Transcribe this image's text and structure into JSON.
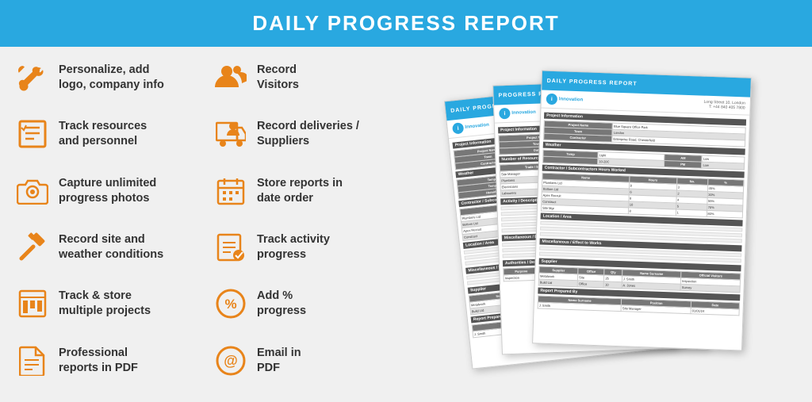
{
  "header": {
    "title": "DAILY PROGRESS REPORT"
  },
  "features": [
    {
      "id": "personalize",
      "icon": "wrench",
      "text": "Personalize, add logo, company info"
    },
    {
      "id": "record-visitors",
      "icon": "visitors",
      "text": "Record Visitors"
    },
    {
      "id": "track-resources",
      "icon": "checklist",
      "text": "Track resources and personnel"
    },
    {
      "id": "record-deliveries",
      "icon": "delivery",
      "text": "Record deliveries / Suppliers"
    },
    {
      "id": "capture-photos",
      "icon": "camera",
      "text": "Capture unlimited progress photos"
    },
    {
      "id": "store-reports",
      "icon": "calendar",
      "text": "Store reports in date order"
    },
    {
      "id": "record-site",
      "icon": "hammer",
      "text": "Record site and weather conditions"
    },
    {
      "id": "track-activity",
      "icon": "activity",
      "text": "Track activity progress"
    },
    {
      "id": "track-projects",
      "icon": "projects",
      "text": "Track & store multiple projects"
    },
    {
      "id": "add-percent",
      "icon": "percent",
      "text": "Add % progress"
    },
    {
      "id": "professional-pdf",
      "icon": "document",
      "text": "Professional reports in PDF"
    },
    {
      "id": "email-pdf",
      "icon": "email",
      "text": "Email in PDF"
    }
  ],
  "report": {
    "title": "DAILY PROGRESS REPORT",
    "company": "Innovation",
    "address": "Long Street 10, London",
    "phone": "T: +44 840 405 7800"
  }
}
